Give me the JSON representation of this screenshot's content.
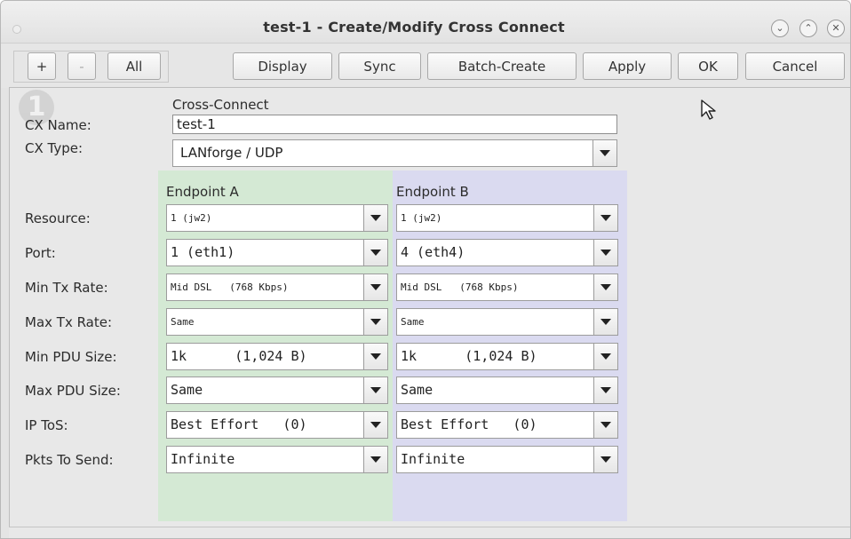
{
  "window": {
    "title": "test-1 - Create/Modify Cross Connect",
    "controls": [
      "minimize-icon",
      "maximize-icon",
      "close-icon"
    ],
    "control_glyphs": [
      "⌄",
      "⌃",
      "✕"
    ]
  },
  "toolbar": {
    "plus_label": "+",
    "minus_label": "-",
    "all_label": "All",
    "display_label": "Display",
    "sync_label": "Sync",
    "batch_create_label": "Batch-Create",
    "apply_label": "Apply",
    "ok_label": "OK",
    "cancel_label": "Cancel"
  },
  "form": {
    "badge_number": "1",
    "section_title": "Cross-Connect",
    "cx_name_label": "CX Name:",
    "cx_name_value": "test-1",
    "cx_type_label": "CX Type:",
    "cx_type_value": "LANforge / UDP",
    "endpoint_a_header": "Endpoint A",
    "endpoint_b_header": "Endpoint B",
    "rows": [
      {
        "label": "Resource:",
        "a": "1 (jw2)",
        "b": "1 (jw2)"
      },
      {
        "label": "Port:",
        "a": "1 (eth1)",
        "b": "4 (eth4)"
      },
      {
        "label": "Min Tx Rate:",
        "a": "Mid DSL   (768 Kbps)",
        "b": "Mid DSL   (768 Kbps)"
      },
      {
        "label": "Max Tx Rate:",
        "a": "Same",
        "b": "Same"
      },
      {
        "label": "Min PDU Size:",
        "a": "1k      (1,024 B)",
        "b": "1k      (1,024 B)"
      },
      {
        "label": "Max PDU Size:",
        "a": "Same",
        "b": "Same"
      },
      {
        "label": "IP ToS:",
        "a": "Best Effort   (0)",
        "b": "Best Effort   (0)"
      },
      {
        "label": "Pkts To Send:",
        "a": "Infinite",
        "b": "Infinite"
      }
    ]
  },
  "colors": {
    "endpoint_a_bg": "#d4e9d4",
    "endpoint_b_bg": "#dadaf0",
    "window_bg": "#e4e4e4"
  }
}
